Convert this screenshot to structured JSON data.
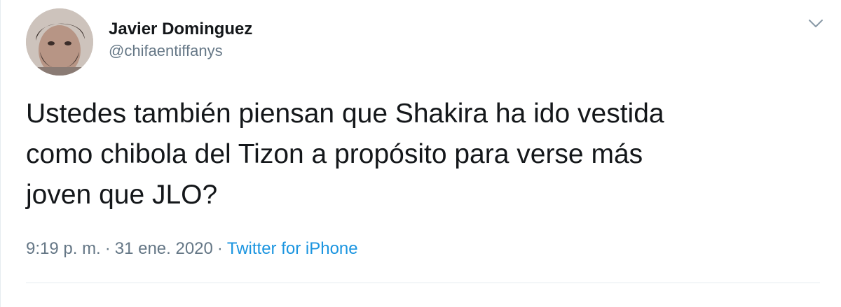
{
  "tweet": {
    "author": {
      "display_name": "Javier Dominguez",
      "handle": "@chifaentiffanys"
    },
    "text": "Ustedes también piensan que Shakira ha ido vestida\ncomo chibola del Tizon a propósito para verse más\njoven que JLO?",
    "time": "9:19 p. m.",
    "separator": "·",
    "date": "31 ene. 2020",
    "source": "Twitter for iPhone",
    "menu_icon": "chevron-down-icon"
  },
  "colors": {
    "text": "#14171a",
    "secondary": "#657786",
    "link": "#1b95e0",
    "divider": "#e6ecf0"
  }
}
